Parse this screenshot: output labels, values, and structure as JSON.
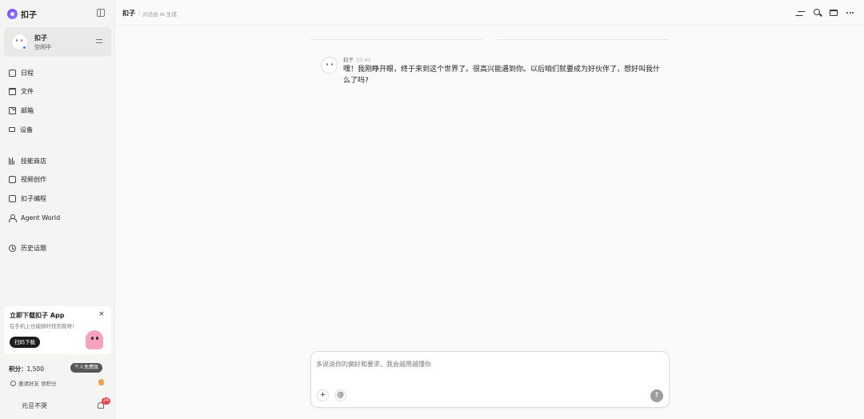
{
  "brand": {
    "name": "扣子"
  },
  "profile": {
    "name": "扣子",
    "status": "空闲中"
  },
  "nav_top": [
    {
      "label": "日程",
      "icon": "calendar-icon"
    },
    {
      "label": "文件",
      "icon": "folder-icon"
    },
    {
      "label": "邮箱",
      "icon": "mail-icon"
    },
    {
      "label": "设备",
      "icon": "device-icon"
    }
  ],
  "nav_mid": [
    {
      "label": "技能商店",
      "icon": "skills-icon"
    },
    {
      "label": "视频创作",
      "icon": "video-icon"
    },
    {
      "label": "扣子编程",
      "icon": "code-icon"
    },
    {
      "label": "Agent World",
      "icon": "agent-world-icon"
    }
  ],
  "nav_bottom": [
    {
      "label": "历史话题",
      "icon": "history-icon"
    }
  ],
  "promo": {
    "title": "立即下载扣子 App",
    "subtitle": "在手机上也能随时找到我呀!",
    "button": "扫码下载",
    "close": "×"
  },
  "account": {
    "points_label": "积分：",
    "points_value": "1,500",
    "plan": "个人免费版",
    "invite": "邀请好友 领积分",
    "user_name": "元旦不哭",
    "notifications": "24"
  },
  "topbar": {
    "title": "扣子",
    "separator": "|",
    "subtitle": "对话由 AI 生成"
  },
  "chat": {
    "sender": "扣子",
    "time": "15:41",
    "message": "嘿！我刚睁开眼，终于来到这个世界了。很高兴能遇到你。以后咱们就要成为好伙伴了，想好叫我什么了吗?"
  },
  "composer": {
    "placeholder": "多说说你的偏好和要求，我会越用越懂你",
    "add_label": "+",
    "mention_label": "@",
    "send_label": "↑"
  },
  "colors": {
    "sidebar_bg": "#f4f4f3",
    "main_bg": "#fafafa",
    "brand_accent": "#6b4cff",
    "status_dot": "#3b7cf5",
    "badge_red": "#e5484d"
  }
}
